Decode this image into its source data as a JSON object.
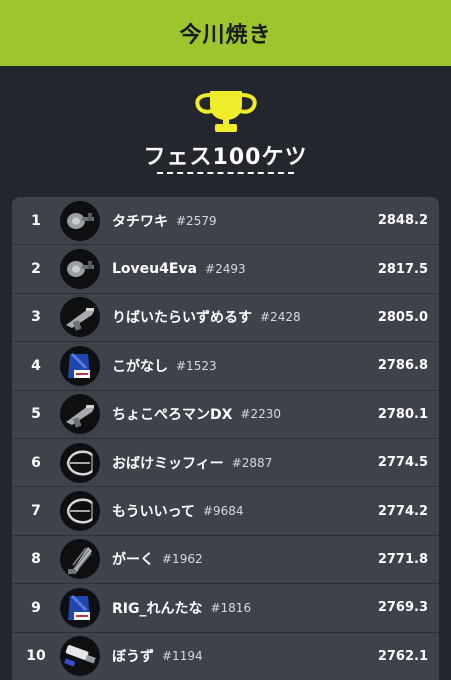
{
  "header": {
    "title": "今川焼き"
  },
  "colors": {
    "accent": "#9dc62e",
    "trophy": "#f0ed2a",
    "background": "#23262c",
    "panel": "#3e424b"
  },
  "leaderboard": {
    "title": "フェス100ケツ",
    "icon": "trophy-icon",
    "rows": [
      {
        "rank": "1",
        "name": "タチワキ",
        "tag": "#2579",
        "score": "2848.2",
        "weapon": "roller-weapon-icon"
      },
      {
        "rank": "2",
        "name": "Loveu4Eva",
        "tag": "#2493",
        "score": "2817.5",
        "weapon": "roller-weapon-icon"
      },
      {
        "rank": "3",
        "name": "りばいたらいずめるす",
        "tag": "#2428",
        "score": "2805.0",
        "weapon": "shooter-weapon-icon"
      },
      {
        "rank": "4",
        "name": "こがなし",
        "tag": "#1523",
        "score": "2786.8",
        "weapon": "bucket-weapon-icon"
      },
      {
        "rank": "5",
        "name": "ちょこぺろマンDX",
        "tag": "#2230",
        "score": "2780.1",
        "weapon": "shooter-weapon-icon"
      },
      {
        "rank": "6",
        "name": "おばけミッフィー",
        "tag": "#2887",
        "score": "2774.5",
        "weapon": "bow-weapon-icon"
      },
      {
        "rank": "7",
        "name": "もういいって",
        "tag": "#9684",
        "score": "2774.2",
        "weapon": "bow-weapon-icon"
      },
      {
        "rank": "8",
        "name": "がーく",
        "tag": "#1962",
        "score": "2771.8",
        "weapon": "drill-weapon-icon"
      },
      {
        "rank": "9",
        "name": "RIG_れんたな",
        "tag": "#1816",
        "score": "2769.3",
        "weapon": "bucket-weapon-icon"
      },
      {
        "rank": "10",
        "name": "ぼうず",
        "tag": "#1194",
        "score": "2762.1",
        "weapon": "brush-weapon-icon"
      }
    ]
  }
}
